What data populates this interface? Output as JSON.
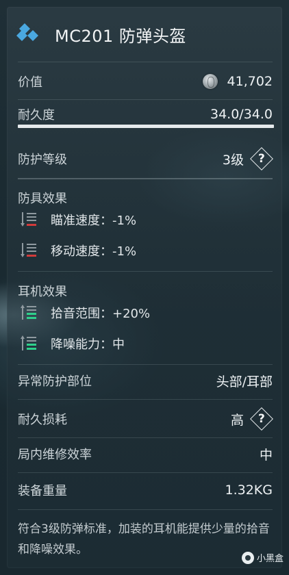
{
  "item": {
    "title": "MC201 防弹头盔",
    "icon": "armor-diamond-icon",
    "accent_color": "#4aa8e0"
  },
  "stats": {
    "value_label": "价值",
    "value": "41,702",
    "value_icon": "silver-coin-icon",
    "durability_label": "耐久度",
    "durability": "34.0/34.0",
    "durability_fraction": 1.0,
    "protection_label": "防护等级",
    "protection": "3级"
  },
  "armor_effects": {
    "title": "防具效果",
    "items": [
      {
        "label": "瞄准速度：-1%",
        "icon": "stat-down-icon",
        "color": "#d23b3b"
      },
      {
        "label": "移动速度：-1%",
        "icon": "stat-down-icon",
        "color": "#d23b3b"
      }
    ]
  },
  "headset_effects": {
    "title": "耳机效果",
    "items": [
      {
        "label": "拾音范围：+20%",
        "icon": "stat-up-icon",
        "color": "#2ed18b"
      },
      {
        "label": "降噪能力：中",
        "icon": "stat-up-icon",
        "color": "#2ed18b"
      }
    ]
  },
  "details": {
    "abnormal_label": "异常防护部位",
    "abnormal_value": "头部/耳部",
    "wear_label": "耐久损耗",
    "wear_value": "高",
    "repair_label": "局内维修效率",
    "repair_value": "中",
    "weight_label": "装备重量",
    "weight_value": "1.32KG"
  },
  "help_glyph": "?",
  "description": "符合3级防弹标准，加装的耳机能提供少量的拾音和降噪效果。",
  "watermark": "小黑盒"
}
